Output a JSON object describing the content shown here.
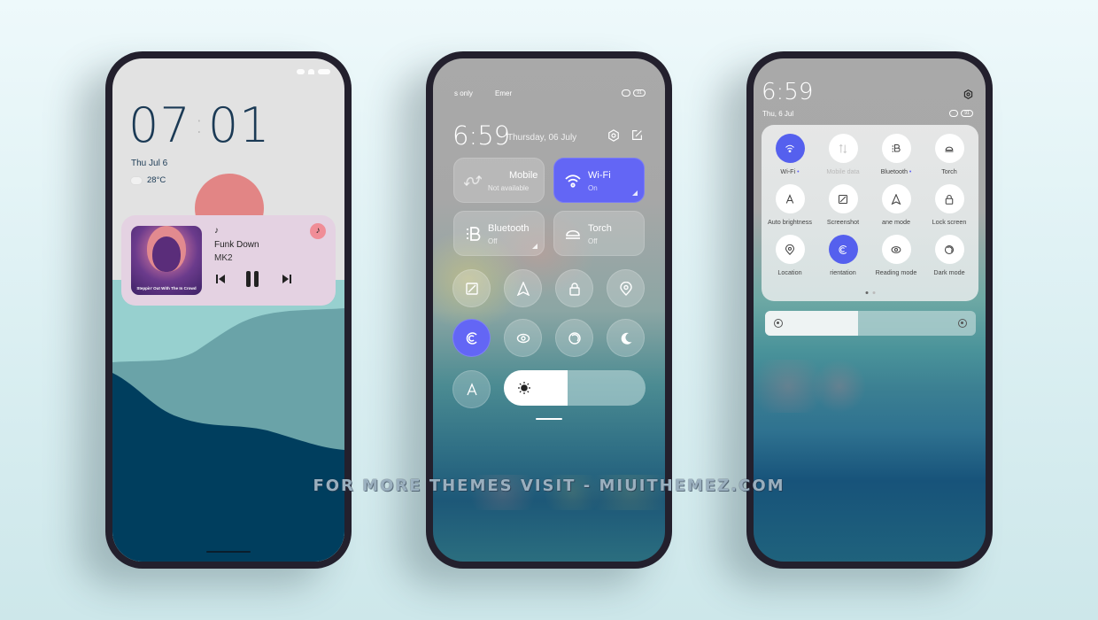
{
  "watermark": "FOR MORE THEMES VISIT - MIUITHEMEZ.COM",
  "colors": {
    "accent": "#6366f5",
    "lockscreen_text": "#1b3a55",
    "sun": "#e28585",
    "music_card": "#e4d2e2",
    "wave_light": "#97d0cf",
    "wave_mid": "#6aa3a8",
    "wave_dark": "#003e5e"
  },
  "lockscreen": {
    "time_hours": "07",
    "time_minutes": "01",
    "date": "Thu Jul 6",
    "weather_icon": "partly-cloudy-icon",
    "temperature": "28°C",
    "music": {
      "note_icon": "♪",
      "title": "Funk Down",
      "artist": "MK2",
      "album_caption": "Steppin' Out With The In Crowd",
      "prev_icon": "⏮",
      "next_icon": "⏭"
    }
  },
  "control_center": {
    "top_left": "s only",
    "top_mid": "Emer",
    "battery": "91",
    "time": "6:59",
    "date": "Thursday, 06 July",
    "tiles": [
      {
        "label": "Mobile",
        "sub": "Not available",
        "active": false
      },
      {
        "label": "Wi-Fi",
        "sub": "On",
        "active": true
      },
      {
        "label": "Bluetooth",
        "sub": "Off",
        "active": false
      },
      {
        "label": "Torch",
        "sub": "Off",
        "active": false
      }
    ],
    "round_buttons": [
      {
        "name": "screenshot",
        "active": false
      },
      {
        "name": "airplane-mode",
        "active": false
      },
      {
        "name": "lock-screen",
        "active": false
      },
      {
        "name": "location",
        "active": false
      },
      {
        "name": "rotation-lock",
        "active": true
      },
      {
        "name": "reading-mode",
        "active": false
      },
      {
        "name": "dark-mode",
        "active": false
      },
      {
        "name": "moon",
        "active": false
      },
      {
        "name": "auto-brightness",
        "active": false
      }
    ],
    "brightness": 0.45
  },
  "quick_settings": {
    "time": "6:59",
    "date": "Thu, 6 Jul",
    "battery": "91",
    "items": [
      {
        "label": "Wi-Fi",
        "active": true,
        "dot": true
      },
      {
        "label": "Mobile data",
        "active": false,
        "dim": true
      },
      {
        "label": "Bluetooth",
        "active": false,
        "dot": true
      },
      {
        "label": "Torch",
        "active": false
      },
      {
        "label": "Auto brightness",
        "active": false
      },
      {
        "label": "Screenshot",
        "active": false
      },
      {
        "label": "ane mode",
        "active": false
      },
      {
        "label": "Lock screen",
        "active": false
      },
      {
        "label": "Location",
        "active": false
      },
      {
        "label": "rientation",
        "active": true
      },
      {
        "label": "Reading mode",
        "active": false
      },
      {
        "label": "Dark mode",
        "active": false
      }
    ],
    "page": 1,
    "pages": 2,
    "brightness": 0.44
  }
}
